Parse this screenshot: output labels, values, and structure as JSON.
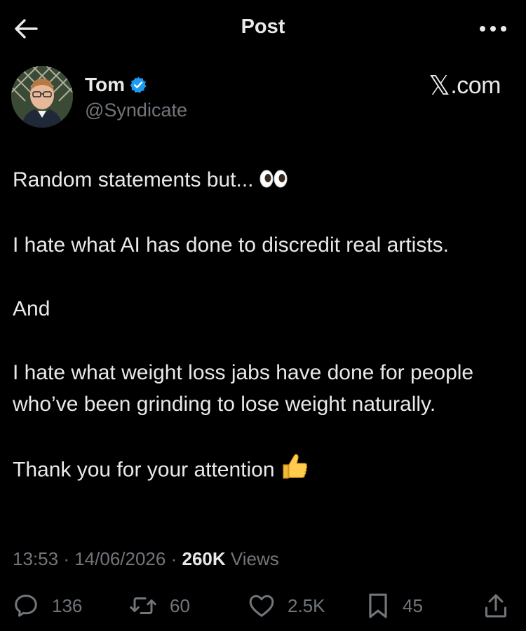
{
  "header": {
    "title": "Post",
    "back_icon": "back-arrow-icon",
    "more_icon": "more-horizontal-icon"
  },
  "author": {
    "name": "Tom",
    "handle": "@Syndicate",
    "verified": true,
    "verified_color": "#1d9bf0"
  },
  "brand": {
    "glyph": "𝕏",
    "text": ".com"
  },
  "post": {
    "lines": [
      "Random statements but... 👀",
      "I hate what AI has done to discredit real artists.",
      "And",
      "I hate what weight loss jabs have done for people who’ve been grinding to lose weight naturally.",
      "Thank you for your attention 👍"
    ],
    "line_1_text": "Random statements but...",
    "line_1_emoji": "eyes-emoji",
    "line_2_text": "I hate what AI has done to discredit real artists.",
    "line_3_text": "And",
    "line_4_text": "I hate what weight loss jabs have done for people who’ve been grinding to lose weight naturally.",
    "line_5_text": "Thank you for your attention",
    "line_5_emoji": "thumbs-up-emoji"
  },
  "meta": {
    "time": "13:53",
    "separator": "·",
    "date": "14/06/2026",
    "views_count": "260K",
    "views_label": "Views"
  },
  "actions": {
    "replies": "136",
    "reposts": "60",
    "likes": "2.5K",
    "bookmarks": "45"
  },
  "colors": {
    "background": "#000000",
    "text_primary": "#e7e9ea",
    "text_secondary": "#71767b",
    "accent": "#1d9bf0"
  }
}
